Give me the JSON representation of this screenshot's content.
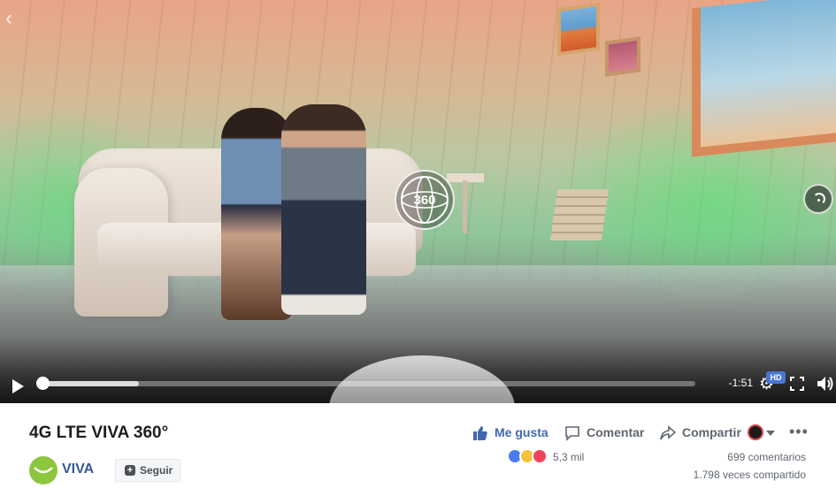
{
  "player": {
    "badge_360": "360",
    "time_remaining": "-1:51",
    "hd_label": "HD",
    "progress_buffered_fraction": 0.15,
    "progress_played_fraction": 0.0
  },
  "post": {
    "title": "4G LTE VIVA 360°",
    "page_name": "VIVA",
    "follow_label": "Seguir",
    "actions": {
      "like": "Me gusta",
      "comment": "Comentar",
      "share": "Compartir"
    },
    "reaction_count": "5,3 mil",
    "comments_count": "699 comentarios",
    "shares_count": "1.798 veces compartido"
  },
  "colors": {
    "link_blue": "#4267b2",
    "page_name_blue": "#365899",
    "viva_green": "#8cc63f",
    "hd_badge": "#4a76d4"
  },
  "icons": [
    "back-chevron-icon",
    "360-icon",
    "compass-icon",
    "play-icon",
    "settings-icon",
    "fullscreen-icon",
    "volume-icon",
    "like-thumb-icon",
    "comment-icon",
    "share-icon",
    "more-icon"
  ]
}
